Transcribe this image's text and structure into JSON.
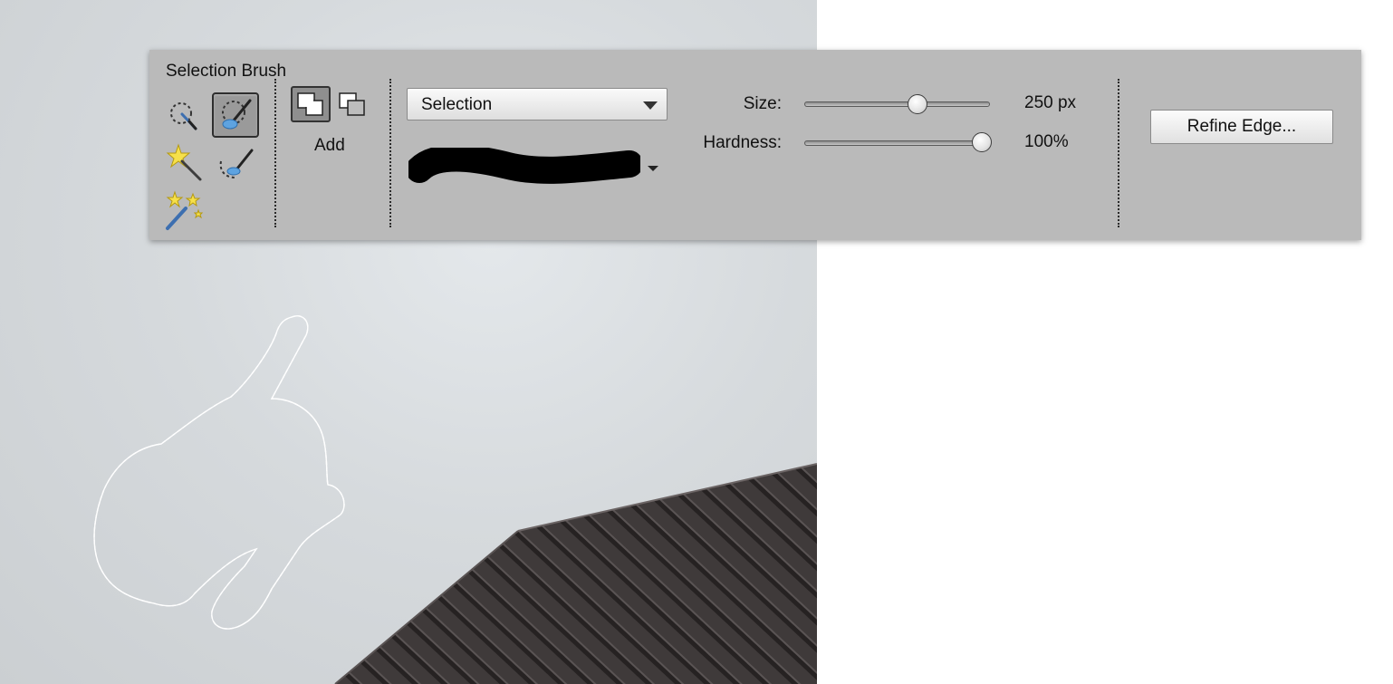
{
  "panel": {
    "title": "Selection Brush",
    "tools": [
      {
        "name": "quick-selection-tool-icon",
        "active": false
      },
      {
        "name": "selection-brush-tool-icon",
        "active": true
      },
      {
        "name": "magic-wand-tool-icon",
        "active": false
      },
      {
        "name": "refine-selection-brush-tool-icon",
        "active": false
      },
      {
        "name": "auto-selection-tool-icon",
        "active": false
      }
    ],
    "mode": {
      "label": "Add",
      "options": [
        "add-to-selection-icon",
        "subtract-from-selection-icon"
      ],
      "selected": "add-to-selection-icon"
    },
    "mode_dropdown": {
      "value": "Selection"
    },
    "brush_picker": {
      "icon": "brush-stroke-preview"
    },
    "size": {
      "label": "Size:",
      "value": 250,
      "display": "250 px",
      "level": 0.62
    },
    "hardness": {
      "label": "Hardness:",
      "value": 100,
      "display": "100%",
      "level": 1.0
    },
    "refine_button": {
      "label": "Refine Edge..."
    }
  },
  "canvas": {
    "description_icon": "marching-ants-selection"
  },
  "colors": {
    "panel_bg": "#bababa",
    "active_tool_bg": "#9a9a9a",
    "brush_accent": "#5ea3e0",
    "roof": "#3b3636",
    "sky": "#d9dde0"
  }
}
